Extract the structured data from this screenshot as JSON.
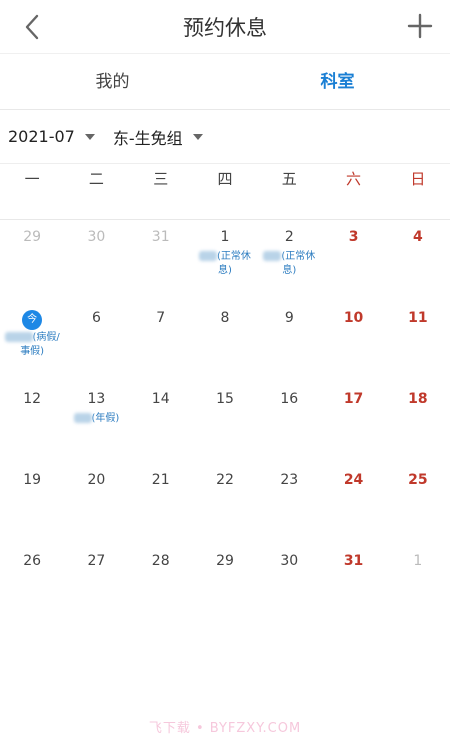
{
  "header": {
    "title": "预约休息",
    "back_icon": "chevron-left-icon",
    "add_icon": "plus-icon"
  },
  "tabs": [
    {
      "label": "我的",
      "active": false
    },
    {
      "label": "科室",
      "active": true
    }
  ],
  "filters": {
    "month": "2021-07",
    "group": "东-生免组"
  },
  "weekdays": [
    "一",
    "二",
    "三",
    "四",
    "五",
    "六",
    "日"
  ],
  "colors": {
    "accent": "#1a7fd4",
    "weekend": "#c0392b",
    "today": "#1e88e5"
  },
  "calendar": {
    "days": [
      {
        "label": "29",
        "other": true
      },
      {
        "label": "30",
        "other": true
      },
      {
        "label": "31",
        "other": true
      },
      {
        "label": "1",
        "note": "(正常休息)"
      },
      {
        "label": "2",
        "note": "(正常休息)"
      },
      {
        "label": "3",
        "weekend": true
      },
      {
        "label": "4",
        "weekend": true
      },
      {
        "label": "今",
        "today": true,
        "note": "(病假/事假)"
      },
      {
        "label": "6"
      },
      {
        "label": "7"
      },
      {
        "label": "8"
      },
      {
        "label": "9"
      },
      {
        "label": "10",
        "weekend": true
      },
      {
        "label": "11",
        "weekend": true
      },
      {
        "label": "12"
      },
      {
        "label": "13",
        "note": "(年假)"
      },
      {
        "label": "14"
      },
      {
        "label": "15"
      },
      {
        "label": "16"
      },
      {
        "label": "17",
        "weekend": true
      },
      {
        "label": "18",
        "weekend": true
      },
      {
        "label": "19"
      },
      {
        "label": "20"
      },
      {
        "label": "21"
      },
      {
        "label": "22"
      },
      {
        "label": "23"
      },
      {
        "label": "24",
        "weekend": true
      },
      {
        "label": "25",
        "weekend": true
      },
      {
        "label": "26"
      },
      {
        "label": "27"
      },
      {
        "label": "28"
      },
      {
        "label": "29"
      },
      {
        "label": "30"
      },
      {
        "label": "31",
        "weekend": true
      },
      {
        "label": "1",
        "other": true
      }
    ]
  },
  "watermark": "飞下载 • BYFZXY.COM"
}
